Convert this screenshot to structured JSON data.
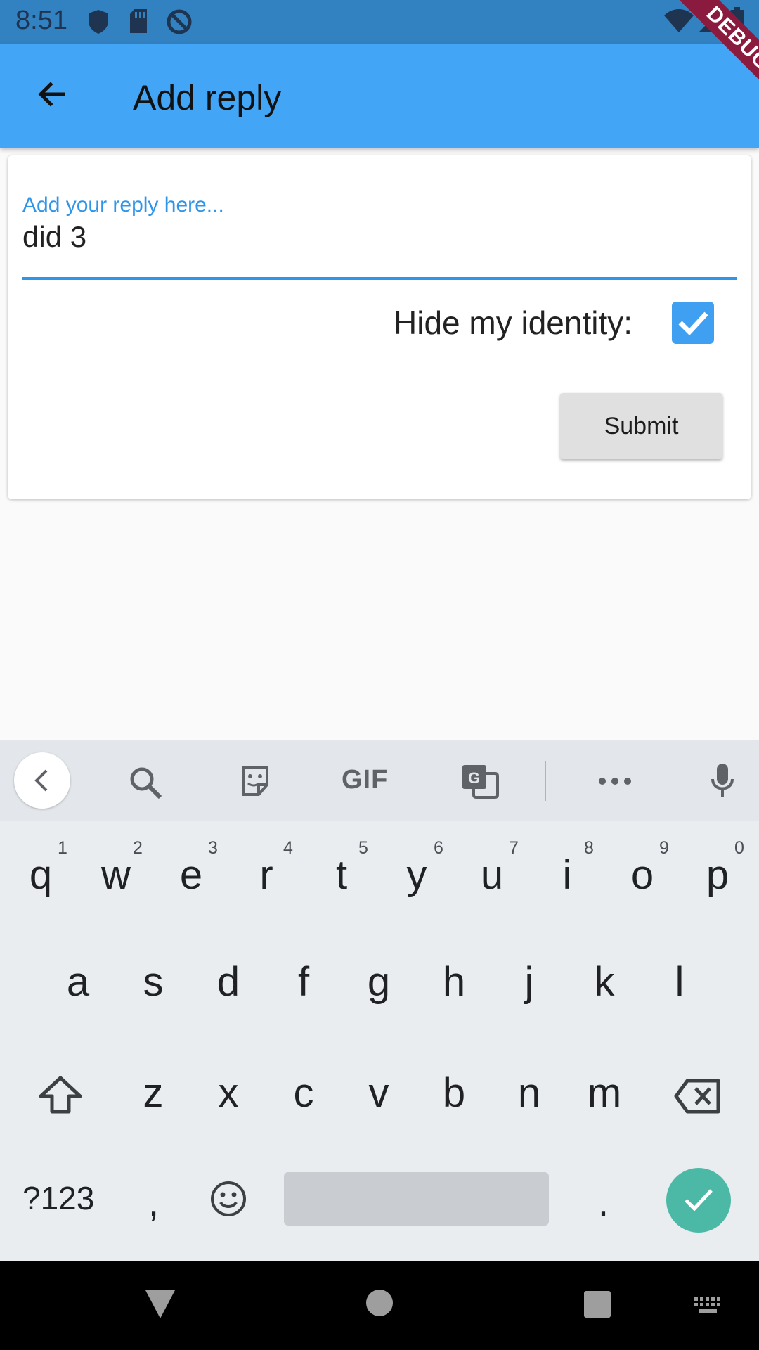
{
  "status_bar": {
    "time": "8:51",
    "debug_label": "DEBUG"
  },
  "app_bar": {
    "title": "Add reply"
  },
  "form": {
    "reply_label": "Add your reply here...",
    "reply_value": "did 3",
    "hide_identity_label": "Hide my identity:",
    "hide_identity_checked": true,
    "submit_label": "Submit"
  },
  "keyboard": {
    "toolbar": [
      "back",
      "search",
      "sticker",
      "GIF",
      "translate",
      "more",
      "mic"
    ],
    "gif_label": "GIF",
    "row1": [
      {
        "key": "q",
        "hint": "1"
      },
      {
        "key": "w",
        "hint": "2"
      },
      {
        "key": "e",
        "hint": "3"
      },
      {
        "key": "r",
        "hint": "4"
      },
      {
        "key": "t",
        "hint": "5"
      },
      {
        "key": "y",
        "hint": "6"
      },
      {
        "key": "u",
        "hint": "7"
      },
      {
        "key": "i",
        "hint": "8"
      },
      {
        "key": "o",
        "hint": "9"
      },
      {
        "key": "p",
        "hint": "0"
      }
    ],
    "row2": [
      "a",
      "s",
      "d",
      "f",
      "g",
      "h",
      "j",
      "k",
      "l"
    ],
    "row3": [
      "z",
      "x",
      "c",
      "v",
      "b",
      "n",
      "m"
    ],
    "symbols_label": "?123",
    "comma": ",",
    "period": "."
  }
}
